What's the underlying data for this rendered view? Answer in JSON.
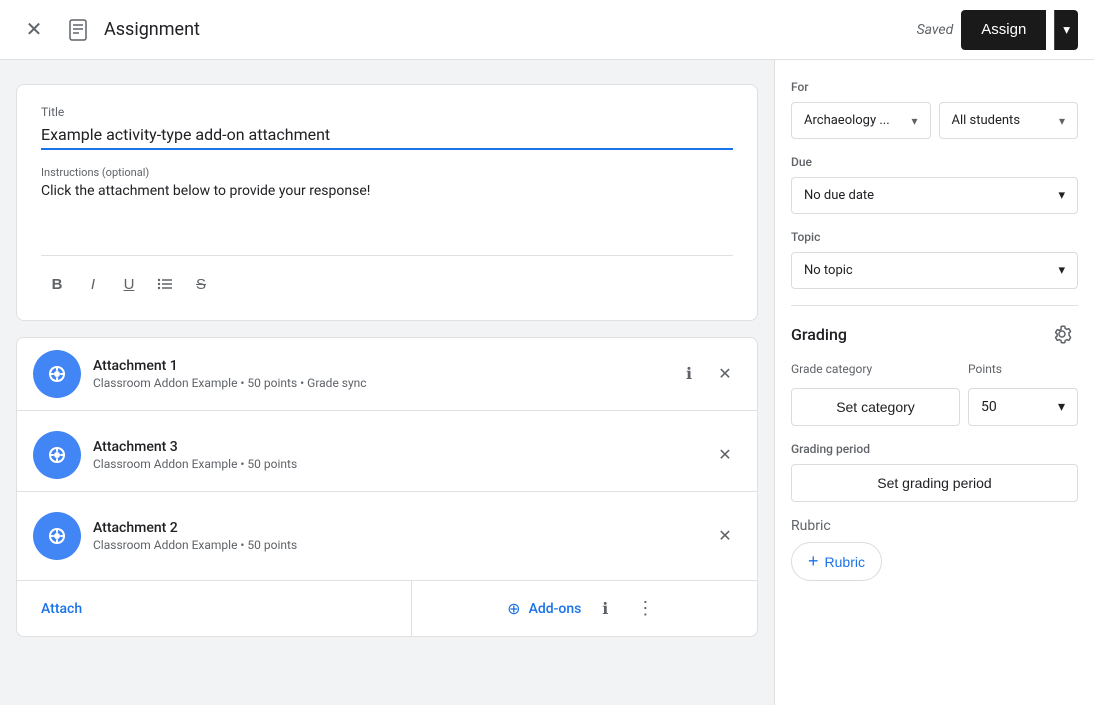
{
  "topBar": {
    "title": "Assignment",
    "savedText": "Saved",
    "assignLabel": "Assign",
    "dropdownArrow": "▾"
  },
  "editor": {
    "titleLabel": "Title",
    "titleValue": "Example activity-type add-on attachment",
    "instructionsLabel": "Instructions (optional)",
    "instructionsText": "Click the attachment below to provide your response!",
    "toolbar": {
      "boldLabel": "B",
      "italicLabel": "I",
      "underlineLabel": "U",
      "listLabel": "≡",
      "strikethroughLabel": "S̶"
    }
  },
  "attachments": [
    {
      "name": "Attachment 1",
      "meta": "Classroom Addon Example • 50 points • Grade sync"
    },
    {
      "name": "Attachment 3",
      "meta": "Classroom Addon Example • 50 points"
    },
    {
      "name": "Attachment 2",
      "meta": "Classroom Addon Example • 50 points"
    }
  ],
  "bottomBar": {
    "attachLabel": "Attach",
    "addonsLabel": "Add-ons"
  },
  "rightPanel": {
    "forLabel": "For",
    "classValue": "Archaeology ...",
    "studentsValue": "All students",
    "dueLabel": "Due",
    "dueDateValue": "No due date",
    "topicLabel": "Topic",
    "topicValue": "No topic",
    "gradingLabel": "Grading",
    "gradeCategoryLabel": "Grade category",
    "pointsLabel": "Points",
    "setCategoryLabel": "Set category",
    "pointsValue": "50",
    "gradingPeriodLabel": "Grading period",
    "setGradingPeriodLabel": "Set grading period",
    "rubricLabel": "Rubric",
    "addRubricLabel": "Rubric",
    "chevron": "▾"
  }
}
